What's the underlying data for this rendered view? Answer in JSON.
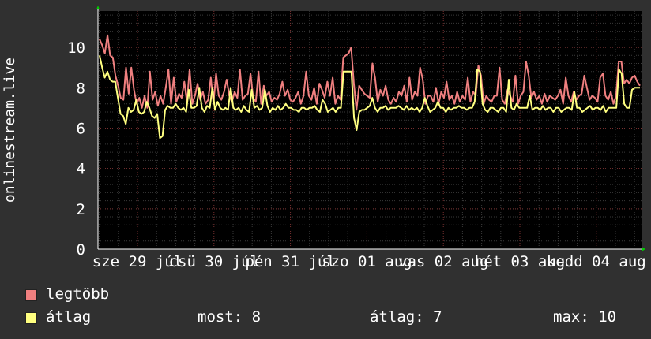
{
  "chart_data": {
    "type": "line",
    "title": "",
    "ylabel": "onlinestream.live",
    "xlabel": "",
    "ylim": [
      0,
      11.8
    ],
    "yticks": [
      0,
      2,
      4,
      6,
      8,
      10
    ],
    "xlim": [
      0,
      8
    ],
    "grid": true,
    "xtick_labels": [
      {
        "label": "sze 29 júl",
        "x": 0.0
      },
      {
        "label": "csü 30 júl",
        "x": 1.0
      },
      {
        "label": "pén 31 júl",
        "x": 2.0
      },
      {
        "label": "szo 01 aug",
        "x": 3.0
      },
      {
        "label": "vas 02 aug",
        "x": 4.0
      },
      {
        "label": "hét 03 aug",
        "x": 5.0
      },
      {
        "label": "kedd 04 aug",
        "x": 6.0
      }
    ],
    "series": [
      {
        "name": "legtöbb",
        "color": "#f08080",
        "values": [
          10.4,
          10.1,
          9.7,
          10.6,
          9.6,
          9.5,
          8.6,
          8.1,
          7.5,
          7.4,
          9.0,
          7.7,
          9.0,
          7.9,
          7.2,
          7.5,
          7.0,
          7.6,
          7.0,
          8.8,
          7.4,
          7.8,
          7.1,
          7.6,
          7.2,
          8.0,
          8.9,
          7.2,
          8.5,
          7.3,
          7.7,
          7.5,
          8.3,
          7.3,
          8.9,
          7.2,
          7.6,
          8.2,
          7.4,
          7.8,
          7.2,
          7.4,
          8.5,
          7.2,
          8.7,
          7.6,
          7.4,
          7.8,
          8.4,
          7.6,
          7.3,
          7.8,
          7.5,
          8.9,
          7.4,
          7.6,
          7.7,
          8.7,
          7.5,
          7.3,
          8.8,
          7.2,
          8.1,
          7.6,
          7.8,
          7.3,
          7.5,
          7.4,
          7.7,
          8.3,
          7.6,
          7.9,
          7.4,
          7.3,
          7.5,
          7.8,
          7.2,
          7.6,
          8.8,
          7.6,
          7.4,
          8.0,
          7.2,
          8.2,
          7.9,
          7.5,
          8.3,
          7.6,
          8.5,
          7.2,
          7.6,
          7.4,
          9.5,
          9.6,
          9.7,
          10.0,
          8.2,
          6.9,
          8.1,
          7.9,
          7.7,
          7.6,
          7.5,
          9.2,
          8.5,
          7.3,
          7.9,
          7.6,
          8.1,
          7.4,
          7.2,
          7.5,
          7.3,
          7.8,
          7.6,
          8.1,
          7.3,
          8.5,
          7.4,
          7.8,
          7.6,
          9.0,
          8.4,
          7.2,
          7.6,
          7.6,
          7.3,
          8.0,
          7.2,
          7.8,
          7.5,
          8.3,
          7.4,
          7.6,
          7.2,
          7.8,
          7.3,
          7.6,
          7.4,
          8.5,
          7.3,
          7.8,
          7.6,
          9.1,
          8.6,
          7.2,
          7.6,
          7.4,
          7.3,
          7.6,
          7.6,
          9.0,
          7.4,
          7.2,
          7.9,
          7.6,
          7.3,
          8.6,
          7.2,
          7.6,
          7.8,
          9.3,
          8.6,
          7.5,
          7.8,
          7.4,
          7.6,
          7.2,
          7.7,
          7.3,
          7.6,
          7.5,
          7.4,
          7.6,
          7.9,
          7.2,
          8.5,
          7.6,
          7.3,
          7.8,
          7.4,
          7.6,
          7.7,
          8.6,
          8.0,
          7.4,
          7.6,
          7.5,
          7.3,
          8.5,
          8.7,
          7.6,
          7.4,
          7.8,
          7.2,
          7.6,
          9.3,
          9.3,
          8.2,
          8.4,
          8.2,
          8.5,
          8.6,
          8.3,
          8.1
        ]
      },
      {
        "name": "átlag",
        "color": "#ffff80",
        "values": [
          9.6,
          9.0,
          8.5,
          8.8,
          8.4,
          8.3,
          8.3,
          7.5,
          6.7,
          6.6,
          6.2,
          7.0,
          6.8,
          6.9,
          7.4,
          6.8,
          6.7,
          6.8,
          7.3,
          7.0,
          6.6,
          6.5,
          6.7,
          5.5,
          5.6,
          6.9,
          7.1,
          7.0,
          7.0,
          7.2,
          7.0,
          6.9,
          7.0,
          6.8,
          7.9,
          7.0,
          7.0,
          7.1,
          8.0,
          7.0,
          6.8,
          7.1,
          7.0,
          8.0,
          6.9,
          7.3,
          7.0,
          6.9,
          7.0,
          6.9,
          8.0,
          7.0,
          6.9,
          7.0,
          6.8,
          7.1,
          6.9,
          6.8,
          7.9,
          7.0,
          7.1,
          6.9,
          7.0,
          7.9,
          7.1,
          6.8,
          7.0,
          6.9,
          7.1,
          6.9,
          7.0,
          7.2,
          7.0,
          7.0,
          6.9,
          6.9,
          6.8,
          7.0,
          7.0,
          6.9,
          7.0,
          7.0,
          7.1,
          6.9,
          6.8,
          7.4,
          7.2,
          6.8,
          6.9,
          7.0,
          6.8,
          7.0,
          7.0,
          8.8,
          8.8,
          8.8,
          8.8,
          6.5,
          5.9,
          6.8,
          6.9,
          6.9,
          7.0,
          7.1,
          7.5,
          7.0,
          6.8,
          7.0,
          7.0,
          7.1,
          6.9,
          7.0,
          7.0,
          7.0,
          7.1,
          7.0,
          6.9,
          7.1,
          6.9,
          7.0,
          6.9,
          7.0,
          6.8,
          7.0,
          7.5,
          7.1,
          6.8,
          6.9,
          7.0,
          7.3,
          7.0,
          7.0,
          6.8,
          7.0,
          6.9,
          7.0,
          7.0,
          7.1,
          7.0,
          7.0,
          6.9,
          7.0,
          7.0,
          7.3,
          8.9,
          8.8,
          7.2,
          6.9,
          6.8,
          7.0,
          7.0,
          6.9,
          6.8,
          7.0,
          7.0,
          6.8,
          8.4,
          7.0,
          6.9,
          7.2,
          7.0,
          7.0,
          7.0,
          7.0,
          7.6,
          6.9,
          7.0,
          7.0,
          6.9,
          7.1,
          6.9,
          7.0,
          7.0,
          6.8,
          7.0,
          7.0,
          6.8,
          6.9,
          7.0,
          7.0,
          6.9,
          7.8,
          7.0,
          7.0,
          6.8,
          6.9,
          7.0,
          7.1,
          6.9,
          7.0,
          7.0,
          6.9,
          7.1,
          6.8,
          7.0,
          7.0,
          7.0,
          7.0,
          8.9,
          8.7,
          7.2,
          7.0,
          7.0,
          7.9,
          8.0,
          8.0,
          8.0
        ]
      }
    ]
  },
  "legend": {
    "items": [
      {
        "label": "legtöbb",
        "color": "#f08080"
      },
      {
        "label": "átlag",
        "color": "#ffff80"
      }
    ],
    "stats": {
      "most": "most: 8",
      "atlag": "átlag: 7",
      "max": "max: 10"
    }
  }
}
